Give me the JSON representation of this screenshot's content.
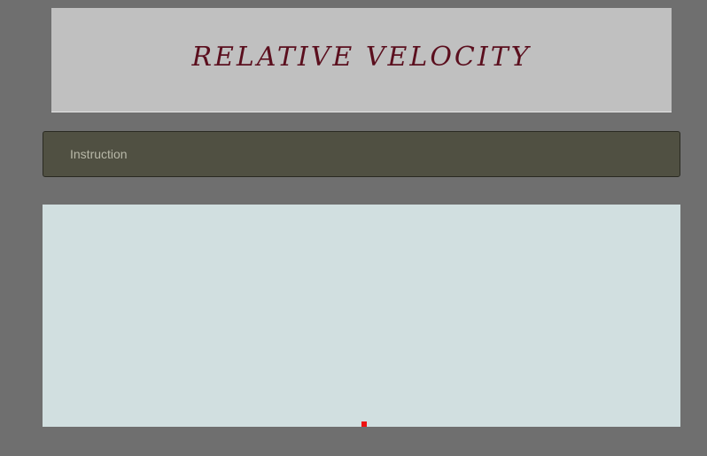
{
  "header": {
    "title": "RELATIVE VELOCITY"
  },
  "instruction": {
    "label": "Instruction"
  },
  "simulation": {
    "marker_color": "#ee1111",
    "background_color": "#d1dfe0"
  }
}
